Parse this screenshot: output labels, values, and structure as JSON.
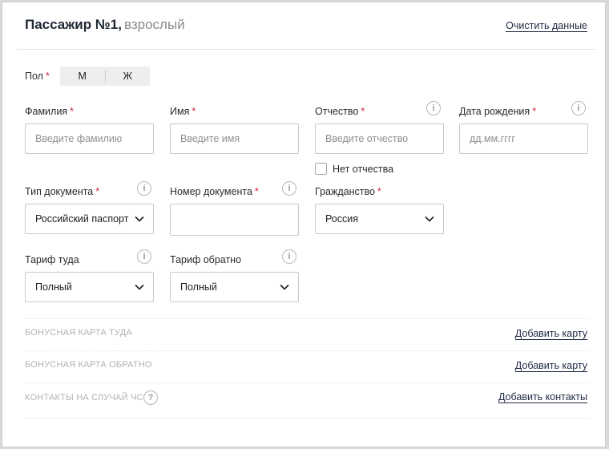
{
  "passenger": {
    "title": "Пассажир №1,",
    "subtitle": "взрослый",
    "clear_link": "Очистить данные"
  },
  "gender": {
    "label": "Пол",
    "required_mark": "*",
    "options": [
      "М",
      "Ж"
    ]
  },
  "fields": {
    "surname": {
      "label": "Фамилия",
      "required_mark": "*",
      "placeholder": "Введите фамилию"
    },
    "name": {
      "label": "Имя",
      "required_mark": "*",
      "placeholder": "Введите имя"
    },
    "patronymic": {
      "label": "Отчество",
      "required_mark": "*",
      "placeholder": "Введите отчество",
      "no_patronymic": "Нет отчества"
    },
    "birthdate": {
      "label": "Дата рождения",
      "required_mark": "*",
      "placeholder": "дд.мм.гггг"
    },
    "doc_type": {
      "label": "Тип документа",
      "required_mark": "*",
      "value": "Российский паспорт"
    },
    "doc_number": {
      "label": "Номер документа",
      "required_mark": "*",
      "value": ""
    },
    "citizenship": {
      "label": "Гражданство",
      "required_mark": "*",
      "value": "Россия"
    },
    "fare_there": {
      "label": "Тариф туда",
      "value": "Полный"
    },
    "fare_back": {
      "label": "Тариф обратно",
      "value": "Полный"
    }
  },
  "sections": {
    "bonus_there": {
      "title": "БОНУСНАЯ КАРТА ТУДА",
      "link": "Добавить карту"
    },
    "bonus_back": {
      "title": "БОНУСНАЯ КАРТА ОБРАТНО",
      "link": "Добавить карту"
    },
    "emergency": {
      "title": "КОНТАКТЫ НА СЛУЧАЙ ЧС",
      "link": "Добавить контакты"
    }
  },
  "icons": {
    "info": "info-icon",
    "help": "question-icon",
    "chevron": "chevron-down-icon"
  },
  "colors": {
    "required": "#d1213a",
    "link": "#1f2a44",
    "border": "#c8c8c8"
  }
}
